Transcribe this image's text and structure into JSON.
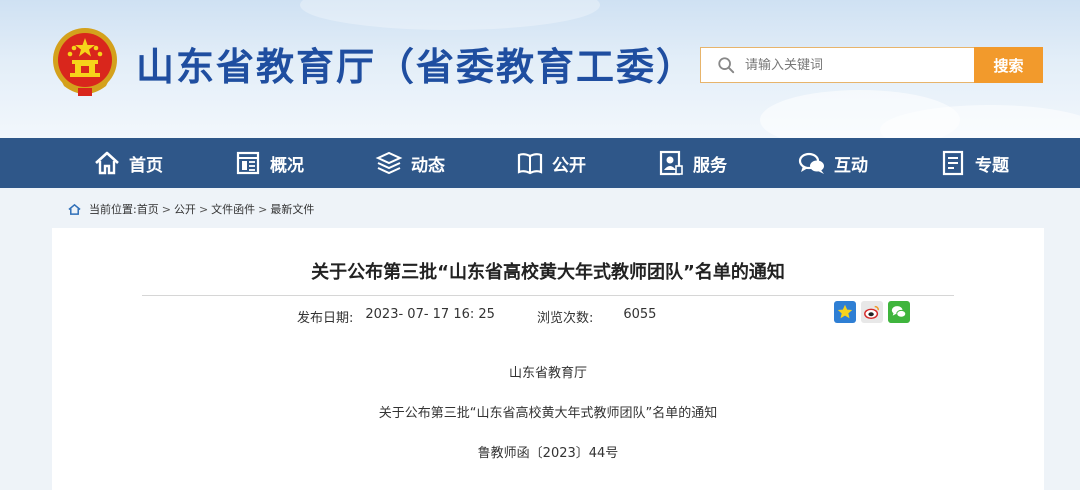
{
  "header": {
    "site_title": "山东省教育厅（省委教育工委）",
    "search_placeholder": "请输入关键词",
    "search_button": "搜索"
  },
  "nav": {
    "items": [
      {
        "label": "首页",
        "icon": "home-icon"
      },
      {
        "label": "概况",
        "icon": "overview-icon"
      },
      {
        "label": "动态",
        "icon": "news-stack-icon"
      },
      {
        "label": "公开",
        "icon": "open-book-icon"
      },
      {
        "label": "服务",
        "icon": "service-icon"
      },
      {
        "label": "互动",
        "icon": "chat-icon"
      },
      {
        "label": "专题",
        "icon": "topic-icon"
      }
    ]
  },
  "breadcrumb": {
    "prefix": "当前位置:",
    "items": [
      "首页",
      "公开",
      "文件函件",
      "最新文件"
    ],
    "separator": ">"
  },
  "article": {
    "title": "关于公布第三批“山东省高校黄大年式教师团队”名单的通知",
    "date_label": "发布日期:",
    "date_value": "2023- 07- 17 16: 25",
    "views_label": "浏览次数:",
    "views_value": "6055",
    "body": [
      "山东省教育厅",
      "关于公布第三批“山东省高校黄大年式教师团队”名单的通知",
      "鲁教师函〔2023〕44号"
    ]
  },
  "share_icons": [
    "favorite-star-icon",
    "weibo-icon",
    "wechat-icon"
  ],
  "colors": {
    "nav_bg": "#2f5789",
    "title_blue": "#1f4ea0",
    "search_button": "#f29a2c"
  }
}
